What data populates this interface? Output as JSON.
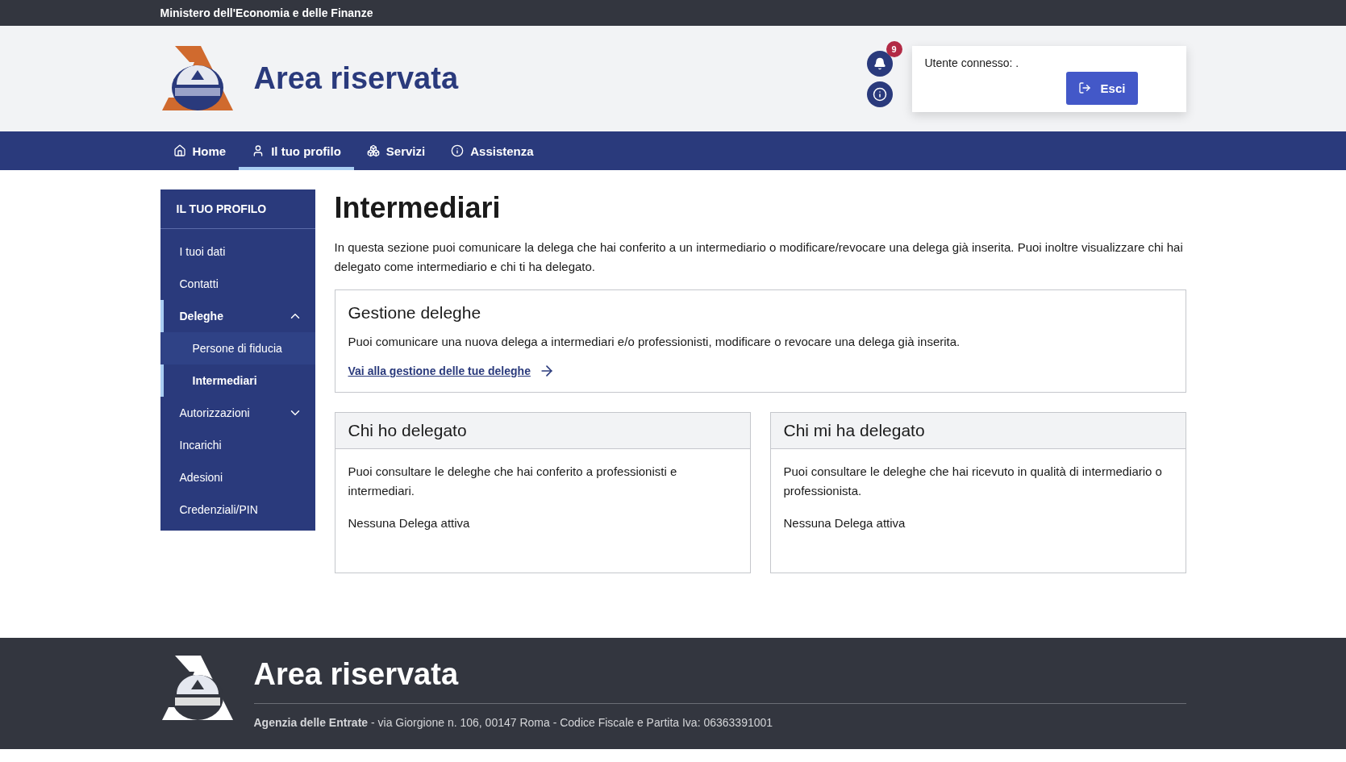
{
  "top_bar": {
    "title": "Ministero dell'Economia e delle Finanze"
  },
  "header": {
    "title": "Area riservata",
    "notifications": {
      "count": "9"
    },
    "user": {
      "label": "Utente connesso: .",
      "logout": "Esci"
    }
  },
  "nav": [
    {
      "label": "Home",
      "selected": false
    },
    {
      "label": "Il tuo profilo",
      "selected": true
    },
    {
      "label": "Servizi",
      "selected": false
    },
    {
      "label": "Assistenza",
      "selected": false
    }
  ],
  "sidebar": {
    "title": "IL TUO PROFILO",
    "items": [
      {
        "label": "I tuoi dati",
        "selected": false
      },
      {
        "label": "Contatti",
        "selected": false
      },
      {
        "label": "Deleghe",
        "selected": true,
        "expanded": true,
        "children": [
          {
            "label": "Persone di fiducia",
            "selected": false
          },
          {
            "label": "Intermediari",
            "selected": true
          }
        ]
      },
      {
        "label": "Autorizzazioni",
        "selected": false,
        "expanded": false
      },
      {
        "label": "Incarichi",
        "selected": false
      },
      {
        "label": "Adesioni",
        "selected": false
      },
      {
        "label": "Credenziali/PIN",
        "selected": false
      }
    ]
  },
  "main": {
    "title": "Intermediari",
    "intro": "In questa sezione puoi comunicare la delega che hai conferito a un intermediario o modificare/revocare una delega già inserita. Puoi inoltre visualizzare chi hai delegato come intermediario e chi ti ha delegato.",
    "gestione": {
      "title": "Gestione deleghe",
      "text": "Puoi comunicare una nuova delega a intermediari e/o professionisti, modificare o revocare una delega già inserita.",
      "link": "Vai alla gestione delle tue deleghe"
    },
    "cards": [
      {
        "title": "Chi ho delegato",
        "text": "Puoi consultare le deleghe che hai conferito a professionisti e intermediari.",
        "status": "Nessuna Delega attiva"
      },
      {
        "title": "Chi mi ha delegato",
        "text": "Puoi consultare le deleghe che hai ricevuto in qualità di intermediario o professionista.",
        "status": "Nessuna Delega attiva"
      }
    ]
  },
  "footer": {
    "title": "Area riservata",
    "address": "**Agenzia delle Entrate** - via Giorgione n. 106, 00147 Roma - Codice Fiscale e Partita Iva: 06363391001"
  }
}
